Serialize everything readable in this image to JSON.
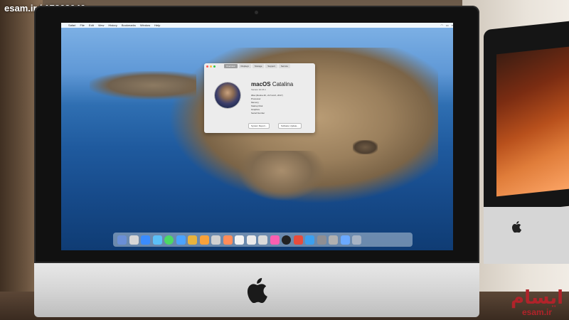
{
  "watermark": {
    "top_text": "esam.ir / 17262040",
    "logo_text": "ایسام",
    "logo_domain": "esam.ir"
  },
  "screen": {
    "menubar": {
      "items": [
        "Safari",
        "File",
        "Edit",
        "View",
        "History",
        "Bookmarks",
        "Window",
        "Help"
      ]
    },
    "about_window": {
      "tabs": [
        "Overview",
        "Displays",
        "Storage",
        "Support",
        "Service"
      ],
      "active_tab": "Overview",
      "os_name_bold": "macOS",
      "os_name_rest": "Catalina",
      "version": "Version 10.15.1",
      "specs": [
        "iMac (Retina 4K, 21.5-inch, 2017)",
        "Processor",
        "Memory",
        "Startup Disk",
        "Graphics",
        "Serial Number"
      ],
      "buttons": [
        "System Report...",
        "Software Update..."
      ]
    },
    "dock_icon_colors": [
      "#6a8fd6",
      "#d6d6d6",
      "#3a8cff",
      "#5bc0f8",
      "#4cd964",
      "#4aa3ff",
      "#e8b33d",
      "#f7a13a",
      "#d0d0d0",
      "#ff8c5a",
      "#f2f2f2",
      "#eaeaea",
      "#d9d9d9",
      "#fa5fb0",
      "#222222",
      "#e74c3c",
      "#3aa0f0",
      "#8e8e93",
      "#b0b0b0",
      "#6aa9ff",
      "#a6b3c4"
    ]
  },
  "colors": {
    "bezel": "#111111",
    "chin": "#d5d5d5",
    "desktop_sky": "#7fb2e6",
    "desktop_sea": "#1f5a9e"
  }
}
